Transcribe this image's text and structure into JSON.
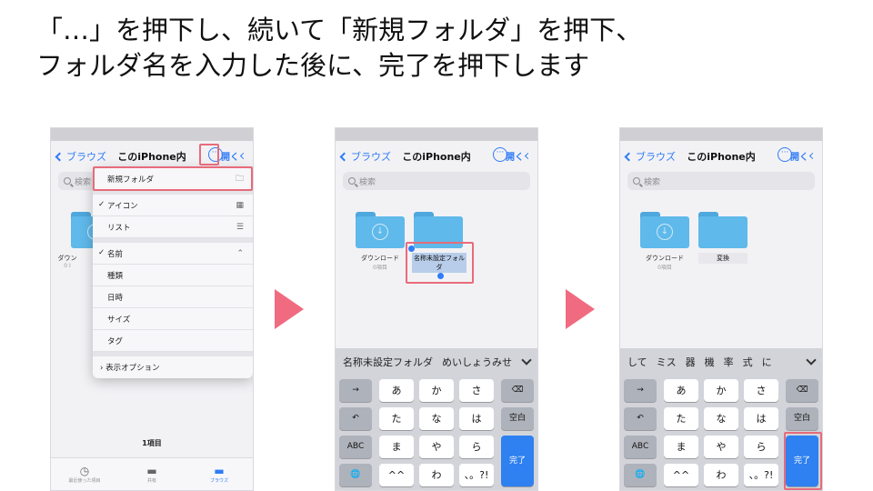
{
  "instruction": {
    "line1": "「…」を押下し、続いて「新規フォルダ」を押下、",
    "line2": "フォルダ名を入力した後に、完了を押下します"
  },
  "nav": {
    "back": "ブラウズ",
    "title": "このiPhone内",
    "more": "···",
    "open": "開く"
  },
  "search_placeholder": "検索",
  "panel1": {
    "partial_search": "検索",
    "partial_folder_name": "ダウン",
    "partial_folder_sub": "0 I",
    "menu": {
      "new_folder": "新規フォルダ",
      "icon": "アイコン",
      "list": "リスト",
      "name": "名前",
      "kind": "種類",
      "date": "日時",
      "size": "サイズ",
      "tag": "タグ",
      "view_options": "表示オプション"
    },
    "items_count": "1項目",
    "tabs": [
      "最近使った項目",
      "共有",
      "ブラウズ"
    ]
  },
  "folders": {
    "download_name": "ダウンロード",
    "download_sub": "0項目",
    "new_default": "名称未設定フォルダ",
    "renamed": "変換"
  },
  "keyboard": {
    "candidates_panel2": [
      "名称未設定フォルダ",
      "めいしょうみせ"
    ],
    "candidates_panel3": [
      "して",
      "ミス",
      "器",
      "機",
      "率",
      "式",
      "に"
    ],
    "arrow": "→",
    "undo": "↶",
    "abc": "ABC",
    "globe": "🌐",
    "kana": [
      "あ",
      "か",
      "さ",
      "た",
      "な",
      "は",
      "ま",
      "や",
      "ら",
      "^^",
      "わ",
      "、。?!"
    ],
    "delete": "⌫",
    "space": "空白",
    "done": "完了"
  },
  "colors": {
    "accent": "#2f7cf6",
    "highlight": "#e86b7b",
    "arrow": "#f06b80",
    "folder": "#5fb9ea"
  }
}
